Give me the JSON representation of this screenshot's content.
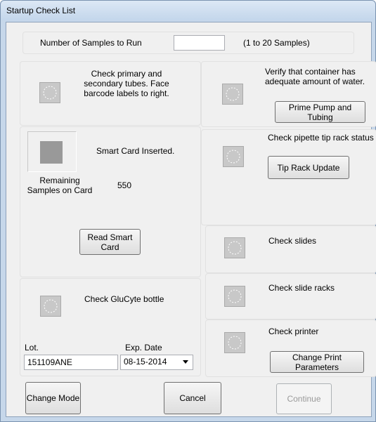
{
  "window": {
    "title": "Startup Check List"
  },
  "samples": {
    "label": "Number of Samples to Run",
    "value": "",
    "hint": "(1 to 20 Samples)"
  },
  "tubes": {
    "text": "Check primary and secondary tubes. Face barcode labels to right."
  },
  "smart_card": {
    "status": "Smart Card Inserted.",
    "remaining_label": "Remaining Samples on Card",
    "remaining_value": "550",
    "read_button": "Read Smart Card"
  },
  "glucyte": {
    "text": "Check GluCyte bottle",
    "lot_label": "Lot.",
    "lot_value": "151109ANE",
    "exp_label": "Exp. Date",
    "exp_value": "08-15-2014"
  },
  "water": {
    "text": "Verify that container has adequate amount of water.",
    "button": "Prime Pump and Tubing"
  },
  "tip_rack": {
    "text": "Check pipette tip rack status",
    "button": "Tip Rack Update"
  },
  "slides": {
    "text": "Check slides"
  },
  "slide_racks": {
    "text": "Check slide racks"
  },
  "printer": {
    "text": "Check printer",
    "button": "Change Print Parameters"
  },
  "footer": {
    "change_mode": "Change Mode",
    "cancel": "Cancel",
    "continue": "Continue"
  },
  "colors": {
    "window_frame": "#c6d7ea",
    "client_bg": "#f0f0f0",
    "checkbox_gray": "#c8c8c8",
    "disabled_text": "#9a9a9a"
  }
}
